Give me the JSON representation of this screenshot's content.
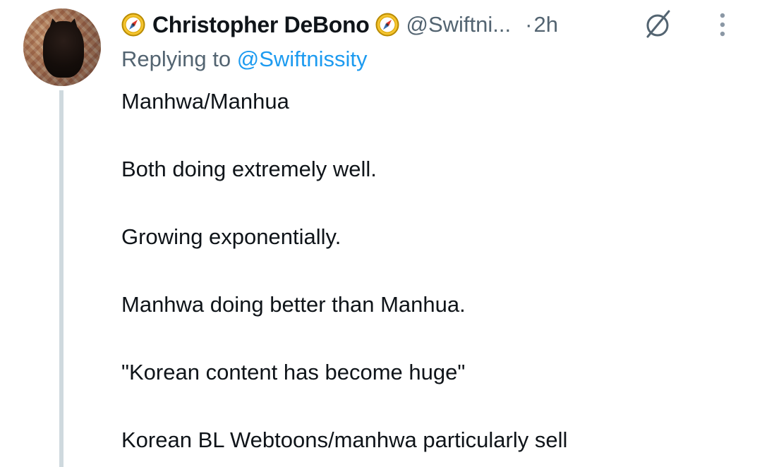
{
  "tweet": {
    "author_name": "Christopher DeBono",
    "handle": "@Swiftni...",
    "separator": "·",
    "time": "2h",
    "replying_prefix": "Replying to",
    "replying_to": "@Swiftnissity",
    "paragraphs": [
      "Manhwa/Manhua",
      "Both doing extremely well.",
      "Growing exponentially.",
      "Manhwa doing better than Manhua.",
      "\"Korean content has become huge\"",
      "Korean BL Webtoons/manhwa particularly sell"
    ]
  },
  "icons": {
    "badge_left": "compass-icon",
    "badge_right": "compass-icon",
    "status": "empty-set-icon",
    "menu": "more-vertical-icon"
  },
  "colors": {
    "text": "#0f1419",
    "muted": "#536471",
    "link": "#1d9bf0",
    "thread_line": "#cfd9de"
  }
}
